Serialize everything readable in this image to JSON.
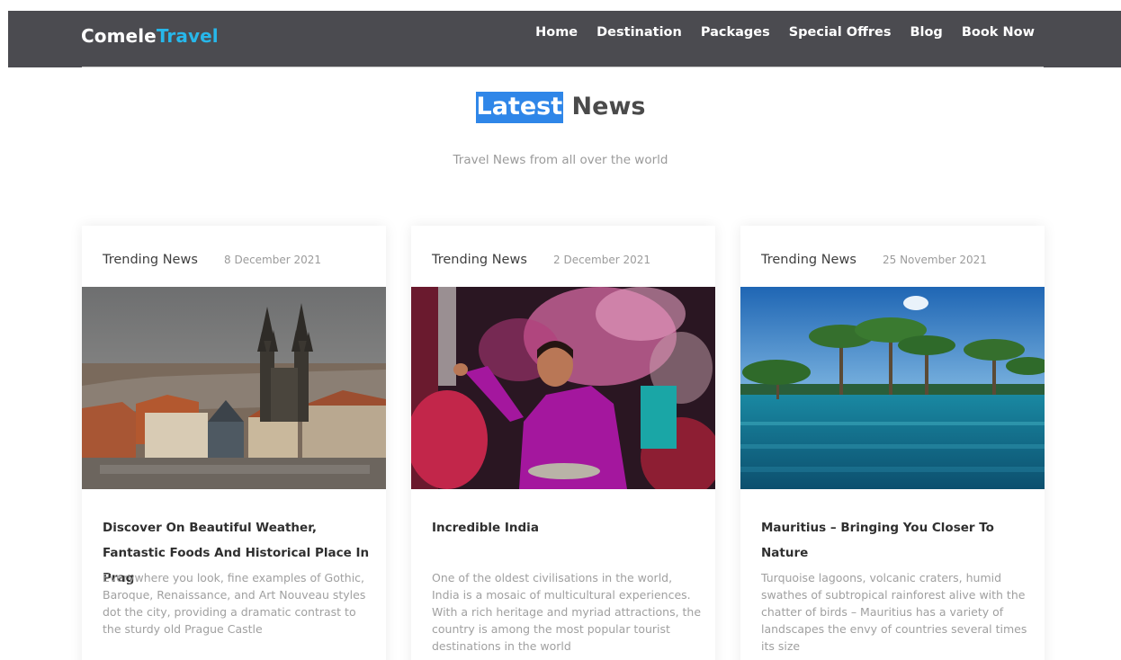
{
  "brand": {
    "part1": "Comele",
    "part2": "Travel",
    "accent_color": "#27b7ea"
  },
  "nav": {
    "items": [
      {
        "label": "Home"
      },
      {
        "label": "Destination"
      },
      {
        "label": "Packages"
      },
      {
        "label": "Special Offres"
      },
      {
        "label": "Blog"
      },
      {
        "label": "Book Now"
      }
    ]
  },
  "section": {
    "title_highlight": "Latest",
    "title_rest": "News",
    "subtitle": "Travel News from all over the world",
    "highlight_color": "#2f86e8"
  },
  "cards": [
    {
      "category": "Trending News",
      "date": "8 December 2021",
      "image_icon": "prague-cityscape-image",
      "title": "Discover On Beautiful Weather, Fantastic Foods And Historical Place In Prag",
      "text": "Everywhere you look, fine examples of Gothic, Baroque, Renaissance, and Art Nouveau styles dot the city, providing a dramatic contrast to the sturdy old Prague Castle"
    },
    {
      "category": "Trending News",
      "date": "2 December 2021",
      "image_icon": "holi-festival-image",
      "title": "Incredible India",
      "text": "One of the oldest civilisations in the world, India is a mosaic of multicultural experiences. With a rich heritage and myriad attractions, the country is among the most popular tourist destinations in the world"
    },
    {
      "category": "Trending News",
      "date": "25 November 2021",
      "image_icon": "tropical-lagoon-image",
      "title": "Mauritius – Bringing You Closer To Nature",
      "text": "Turquoise lagoons, volcanic craters, humid swathes of subtropical rainforest alive with the chatter of birds – Mauritius has a variety of landscapes the envy of countries several times its size"
    }
  ]
}
